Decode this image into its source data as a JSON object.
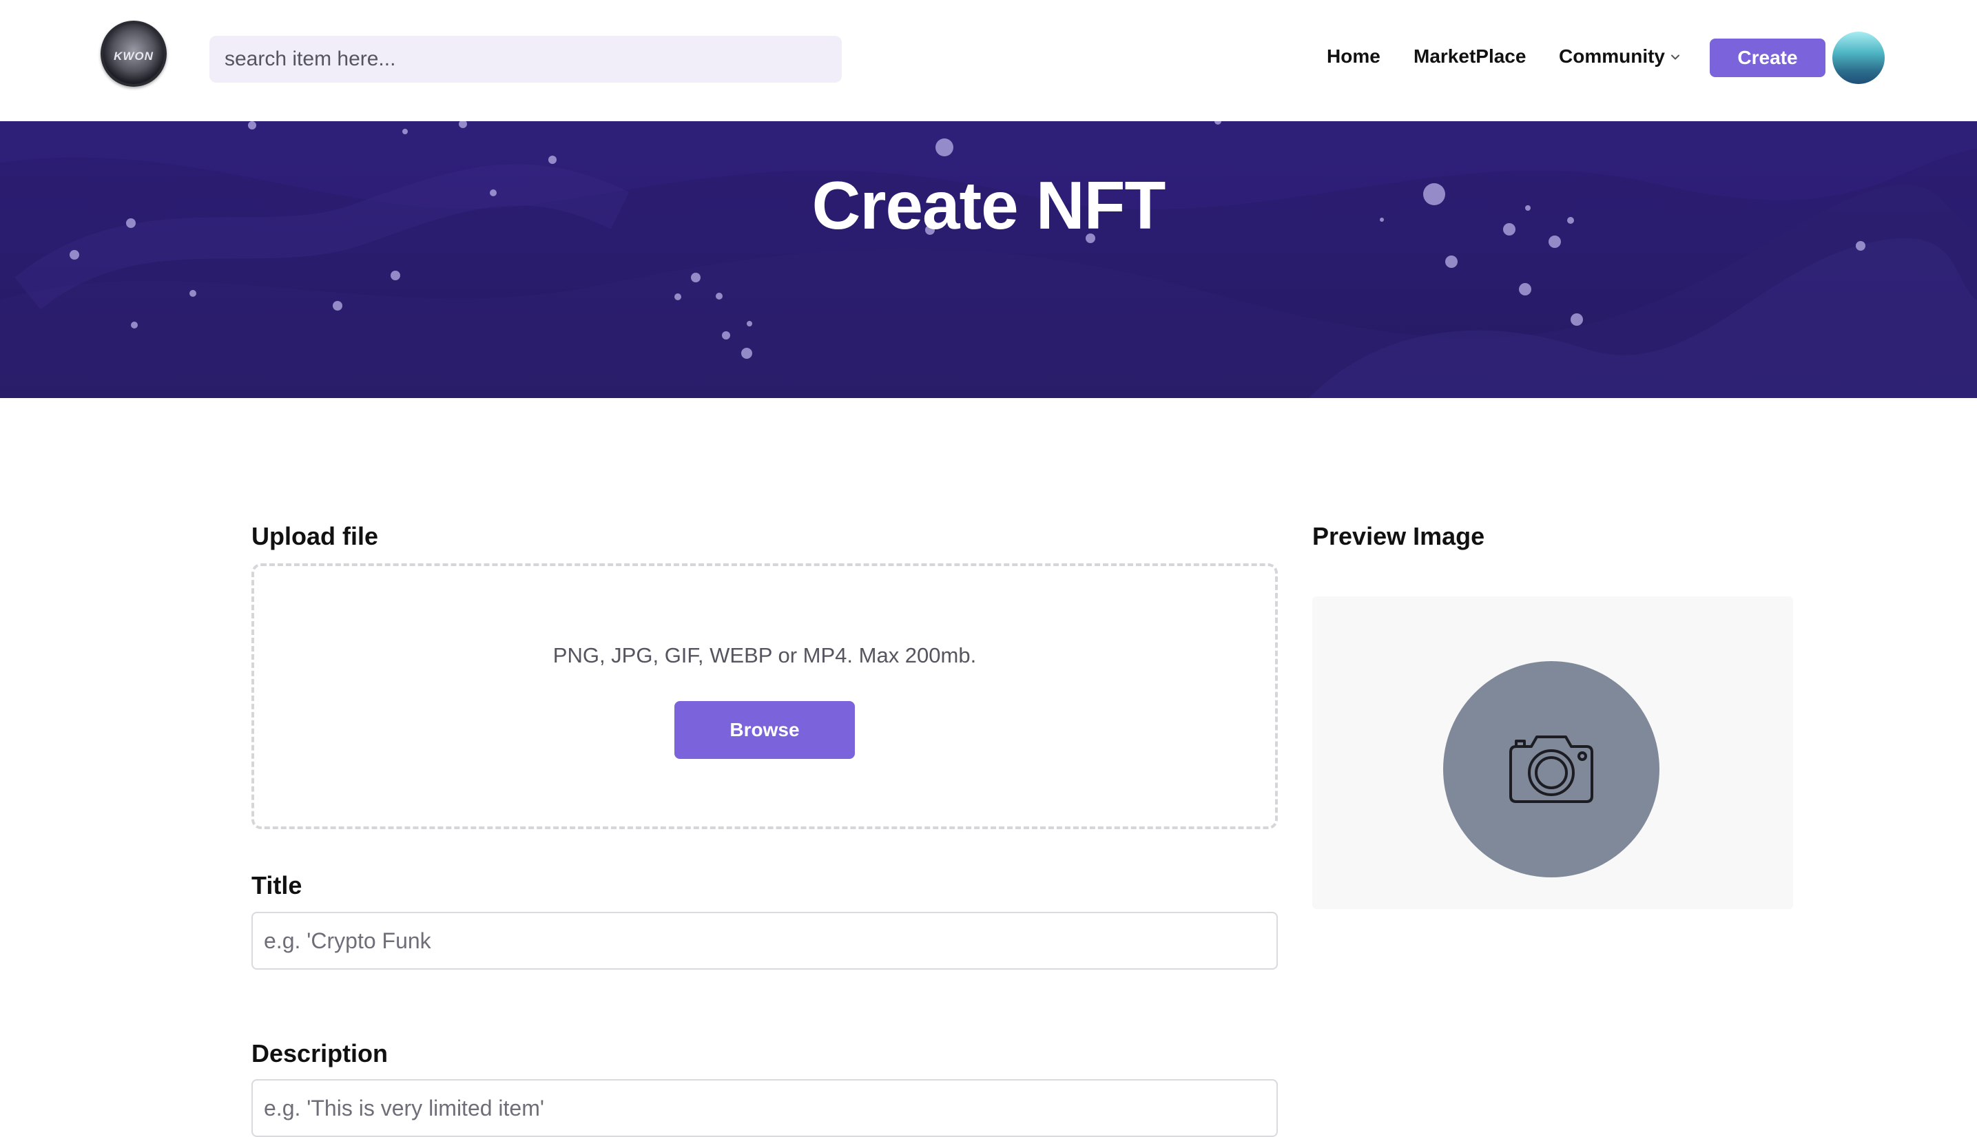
{
  "header": {
    "logo_text": "KWON",
    "search_placeholder": "search item here...",
    "nav": {
      "home": "Home",
      "marketplace": "MarketPlace",
      "community": "Community"
    },
    "create_label": "Create"
  },
  "hero": {
    "title": "Create NFT"
  },
  "form": {
    "upload_label": "Upload file",
    "upload_hint": "PNG, JPG, GIF, WEBP or MP4. Max 200mb.",
    "browse_label": "Browse",
    "preview_label": "Preview Image",
    "title_label": "Title",
    "title_placeholder": "e.g. 'Crypto Funk",
    "description_label": "Description",
    "description_placeholder": "e.g. 'This is very limited item'"
  },
  "colors": {
    "accent": "#7b63db",
    "hero_bg": "#2a1c6e",
    "search_bg": "#f1eef9",
    "preview_circle": "#7f8999"
  },
  "icons": [
    "logo-icon",
    "chevron-down-icon",
    "avatar",
    "camera-icon"
  ]
}
